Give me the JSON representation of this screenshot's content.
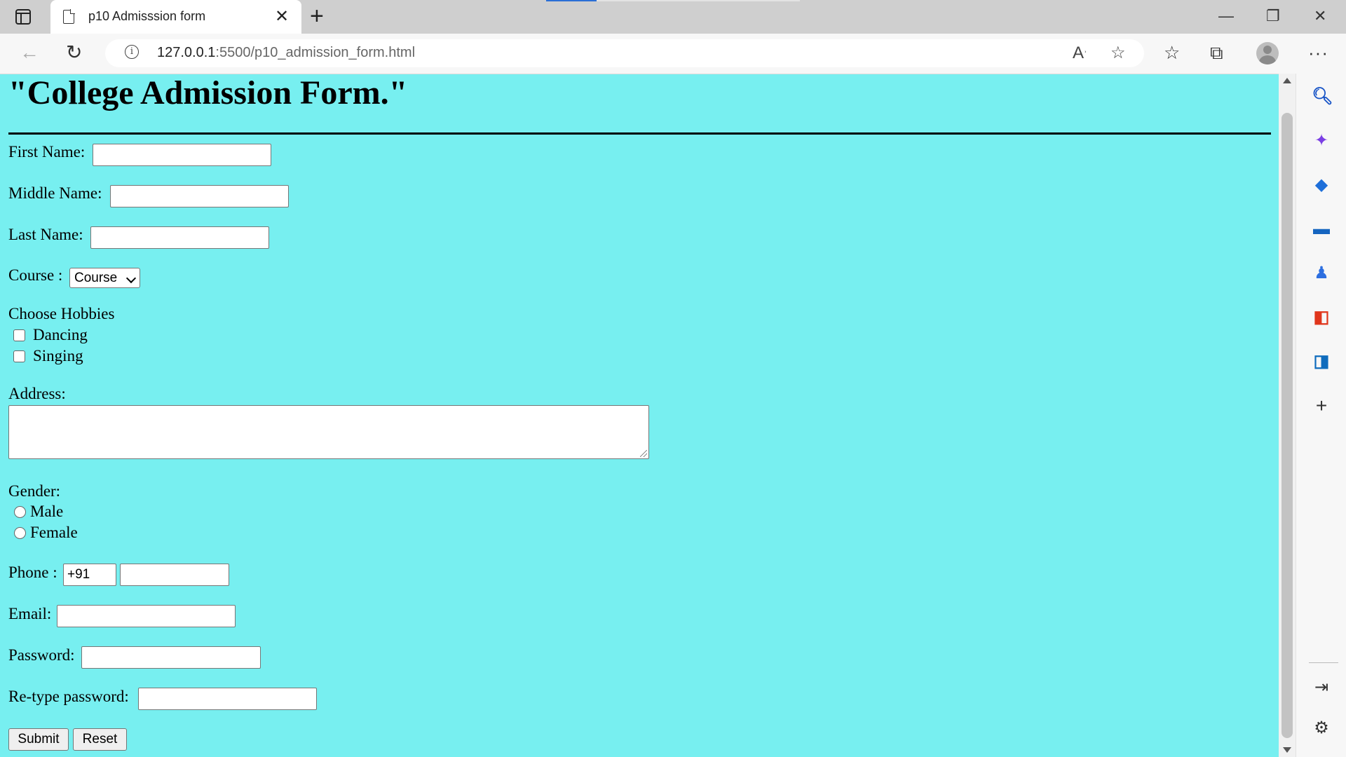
{
  "browser": {
    "tab_title": "p10 Admisssion form",
    "url_host": "127.0.0.1",
    "url_rest": ":5500/p10_admission_form.html"
  },
  "icons": {
    "tab_actions": "tab-actions-icon",
    "page": "page-icon",
    "close": "close-icon",
    "new_tab": "plus-icon",
    "minimize": "minimize-icon",
    "restore": "restore-icon",
    "window_close": "close-icon",
    "back": "back-arrow-icon",
    "refresh": "refresh-icon",
    "info": "info-icon",
    "read_aloud": "read-aloud-icon",
    "add_favorite": "add-favorite-icon",
    "favorites": "favorites-icon",
    "collections": "collections-icon",
    "profile": "profile-icon",
    "more": "more-icon",
    "sidebar": [
      "search-icon",
      "copilot-icon",
      "shopping-icon",
      "tools-icon",
      "games-icon",
      "office-icon",
      "outlook-icon",
      "add-icon",
      "hide-sidebar-icon",
      "settings-icon"
    ]
  },
  "form": {
    "title": "\"College Admission Form.\"",
    "first_name_label": "First Name:",
    "middle_name_label": "Middle Name:",
    "last_name_label": "Last Name:",
    "course_label": "Course :",
    "course_selected": "Course",
    "hobbies_heading": "Choose Hobbies",
    "hobbies": [
      "Dancing",
      "Singing"
    ],
    "address_label": "Address:",
    "gender_label": "Gender:",
    "genders": [
      "Male",
      "Female"
    ],
    "phone_label": "Phone :",
    "phone_code": "+91",
    "email_label": "Email:",
    "password_label": "Password:",
    "retype_password_label": "Re-type password:",
    "submit_label": "Submit",
    "reset_label": "Reset"
  }
}
